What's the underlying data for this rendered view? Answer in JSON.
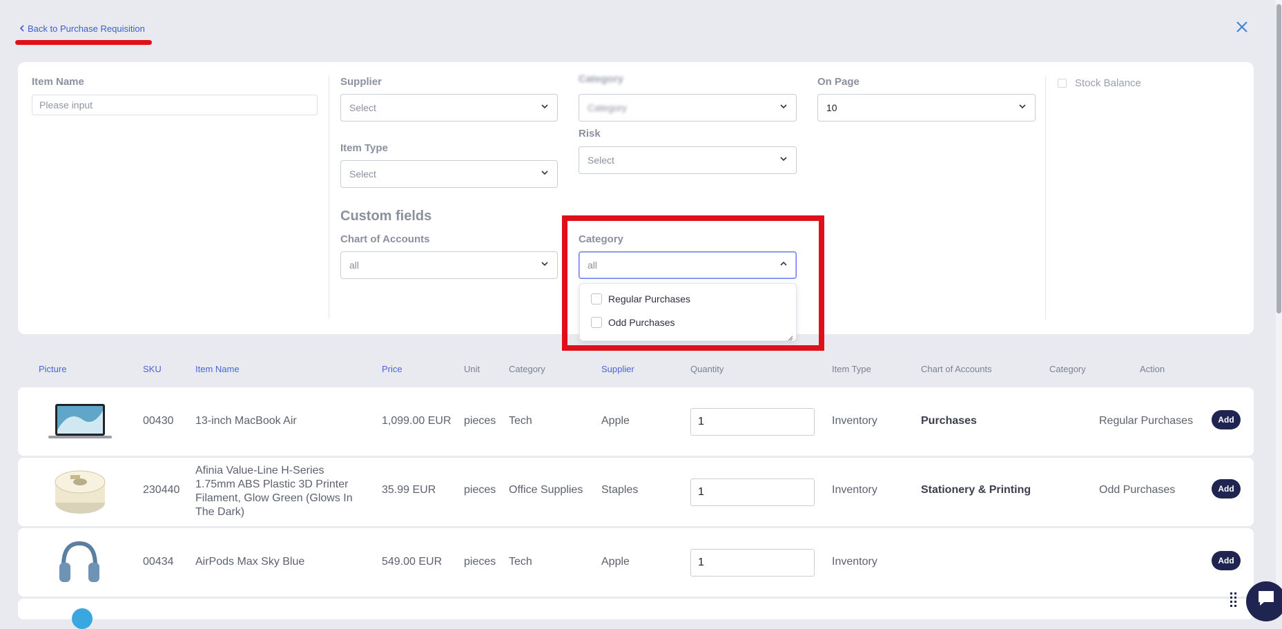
{
  "nav": {
    "back_label": "Back to Purchase Requisition"
  },
  "filters": {
    "item_name": {
      "label": "Item Name",
      "placeholder": "Please input"
    },
    "supplier": {
      "label": "Supplier",
      "value": "Select"
    },
    "category_top": {
      "label": "Category",
      "value": "Category"
    },
    "on_page": {
      "label": "On Page",
      "value": "10"
    },
    "stock_balance": {
      "label": "Stock Balance"
    },
    "item_type": {
      "label": "Item Type",
      "value": "Select"
    },
    "risk": {
      "label": "Risk",
      "value": "Select"
    },
    "custom_fields_title": "Custom fields",
    "chart_of_accounts": {
      "label": "Chart of Accounts",
      "value": "all"
    },
    "category_custom": {
      "label": "Category",
      "value": "all",
      "options": [
        "Regular Purchases",
        "Odd Purchases"
      ]
    }
  },
  "table": {
    "headers": [
      "Picture",
      "SKU",
      "Item Name",
      "Price",
      "Unit",
      "Category",
      "Supplier",
      "Quantity",
      "Item Type",
      "Chart of Accounts",
      "Category",
      "Action"
    ],
    "rows": [
      {
        "sku": "00430",
        "name": "13-inch MacBook Air",
        "price": "1,099.00 EUR",
        "unit": "pieces",
        "category": "Tech",
        "supplier": "Apple",
        "quantity": "1",
        "item_type": "Inventory",
        "chart_of_accounts": "Purchases",
        "custom_category": "Regular Purchases",
        "action": "Add",
        "picture_icon": "laptop-icon"
      },
      {
        "sku": "230440",
        "name_lines": [
          "Afinia Value-Line H-Series",
          "1.75mm ABS Plastic 3D Printer",
          "Filament, Glow Green (Glows In",
          "The Dark)"
        ],
        "price": "35.99 EUR",
        "unit": "pieces",
        "category": "Office Supplies",
        "supplier": "Staples",
        "quantity": "1",
        "item_type": "Inventory",
        "chart_of_accounts": "Stationery & Printing",
        "custom_category": "Odd Purchases",
        "action": "Add",
        "picture_icon": "filament-spool-icon"
      },
      {
        "sku": "00434",
        "name": "AirPods Max Sky Blue",
        "price": "549.00 EUR",
        "unit": "pieces",
        "category": "Tech",
        "supplier": "Apple",
        "quantity": "1",
        "item_type": "Inventory",
        "chart_of_accounts": "",
        "custom_category": "",
        "action": "Add",
        "picture_icon": "headphones-icon"
      }
    ]
  },
  "colors": {
    "accent": "#4a63d6",
    "highlight_red": "#e0101a",
    "button_navy": "#1f2550",
    "background": "#e8eaf0"
  }
}
